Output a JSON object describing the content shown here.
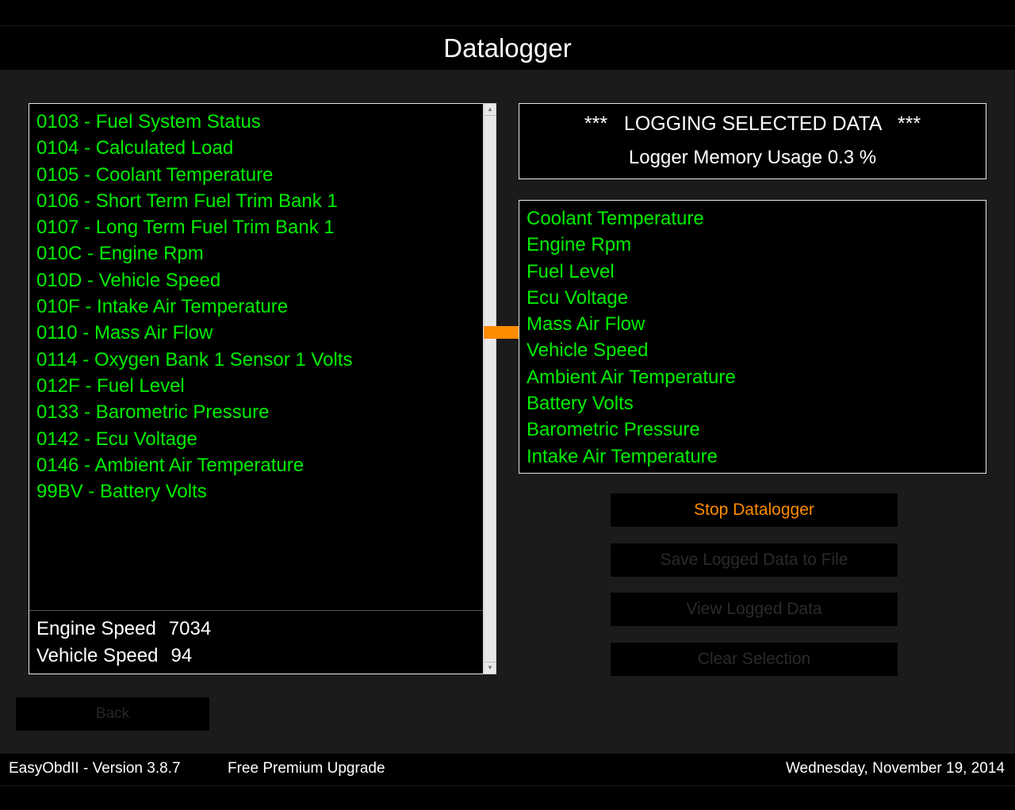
{
  "window": {
    "title": "Datalogger"
  },
  "pid_list": [
    "0103 - Fuel System Status",
    "0104 - Calculated Load",
    "0105 - Coolant Temperature",
    "0106 - Short Term Fuel Trim Bank 1",
    "0107 - Long Term Fuel Trim Bank 1",
    "010C - Engine Rpm",
    "010D - Vehicle Speed",
    "010F - Intake Air Temperature",
    "0110 - Mass Air Flow",
    "0114 - Oxygen Bank 1 Sensor 1 Volts",
    "012F - Fuel Level",
    "0133 - Barometric Pressure",
    "0142 - Ecu Voltage",
    "0146 - Ambient Air Temperature",
    "99BV - Battery Volts"
  ],
  "readouts": [
    {
      "label": "Engine Speed",
      "value": "7034"
    },
    {
      "label": "Vehicle Speed",
      "value": "94"
    }
  ],
  "status": {
    "line1": "***   LOGGING SELECTED DATA   ***",
    "line2": "Logger Memory Usage 0.3 %"
  },
  "selected_items": [
    "Coolant Temperature",
    "Engine Rpm",
    "Fuel Level",
    "Ecu Voltage",
    "Mass Air Flow",
    "Vehicle Speed",
    "Ambient Air Temperature",
    "Battery Volts",
    "Barometric Pressure",
    "Intake Air Temperature"
  ],
  "buttons": {
    "stop": "Stop Datalogger",
    "save": "Save Logged Data to File",
    "view": "View Logged Data",
    "clear": "Clear Selection",
    "back": "Back"
  },
  "footer": {
    "version": "EasyObdII - Version 3.8.7",
    "upgrade": "Free Premium Upgrade",
    "date": "Wednesday, November 19, 2014"
  },
  "colors": {
    "accent": "#ff8c00",
    "list_text": "#00ee00",
    "background": "#1b1b1b"
  }
}
